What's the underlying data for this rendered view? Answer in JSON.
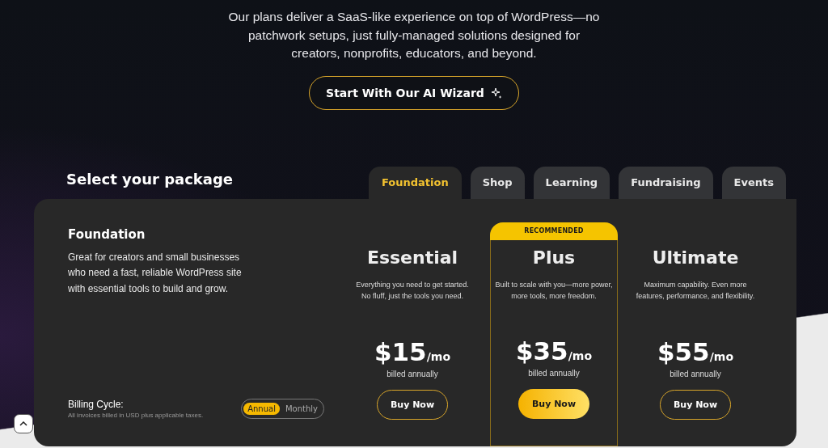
{
  "intro": {
    "text": "Our plans deliver a SaaS-like experience on top of WordPress—no patchwork setups, just fully-managed solutions designed for creators, nonprofits, educators, and beyond.",
    "button": "Start With Our AI Wizard"
  },
  "heading": "Select your package",
  "tabs": [
    {
      "label": "Foundation",
      "selected": true
    },
    {
      "label": "Shop",
      "selected": false
    },
    {
      "label": "Learning",
      "selected": false
    },
    {
      "label": "Fundraising",
      "selected": false
    },
    {
      "label": "Events",
      "selected": false
    }
  ],
  "package": {
    "title": "Foundation",
    "description": "Great for creators and small businesses who need a fast, reliable WordPress site with essential tools to build and grow."
  },
  "billing": {
    "label": "Billing Cycle:",
    "note": "All invoices billed in USD plus applicable taxes.",
    "options": [
      {
        "label": "Annual",
        "selected": true
      },
      {
        "label": "Monthly",
        "selected": false
      }
    ]
  },
  "plans": [
    {
      "name": "Essential",
      "description": "Everything you need to get started. No fluff, just the tools you need.",
      "price": "$15",
      "period": "/mo",
      "billing": "billed annually",
      "button": "Buy Now",
      "recommended": false
    },
    {
      "name": "Plus",
      "badge": "RECOMMENDED",
      "description": "Built to scale with you—more power, more tools, more freedom.",
      "price": "$35",
      "period": "/mo",
      "billing": "billed annually",
      "button": "Buy Now",
      "recommended": true
    },
    {
      "name": "Ultimate",
      "description": "Maximum capability. Even more features, performance, and flexibility.",
      "price": "$55",
      "period": "/mo",
      "billing": "billed annually",
      "button": "Buy Now",
      "recommended": false
    }
  ]
}
